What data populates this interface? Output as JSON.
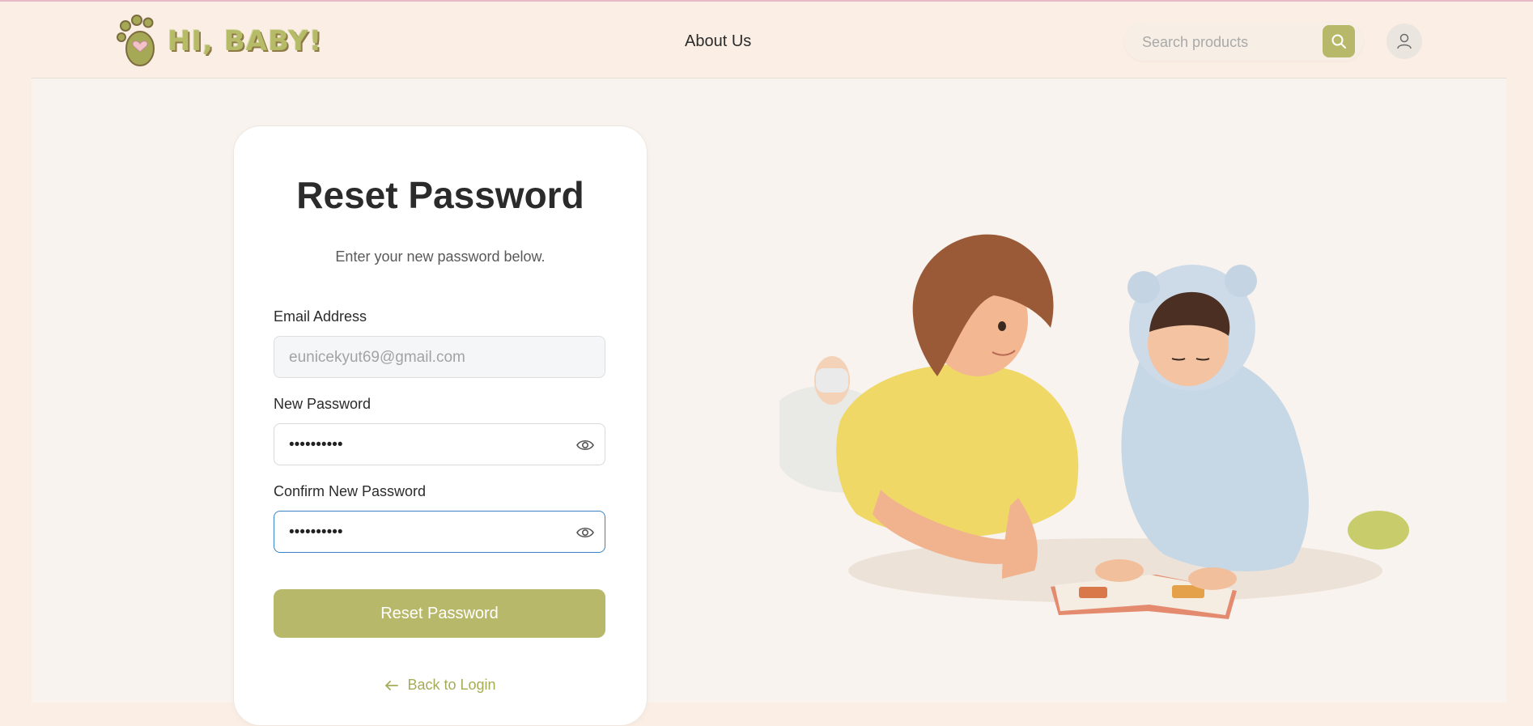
{
  "brand": {
    "name": "HI, BABY!"
  },
  "nav": {
    "about": "About Us"
  },
  "search": {
    "placeholder": "Search products"
  },
  "form": {
    "title": "Reset Password",
    "subtitle": "Enter your new password below.",
    "email_label": "Email Address",
    "email_value": "eunicekyut69@gmail.com",
    "new_password_label": "New Password",
    "new_password_value": "••••••••••",
    "confirm_password_label": "Confirm New Password",
    "confirm_password_value": "••••••••••",
    "submit_label": "Reset Password",
    "back_label": "Back to Login"
  },
  "colors": {
    "accent": "#b8b86a",
    "link": "#a6ac55",
    "focus_border": "#3b82c4",
    "page_bg": "#fbeee4"
  },
  "icons": [
    "paw-logo-icon",
    "search-icon",
    "user-icon",
    "eye-icon",
    "arrow-left-icon"
  ]
}
